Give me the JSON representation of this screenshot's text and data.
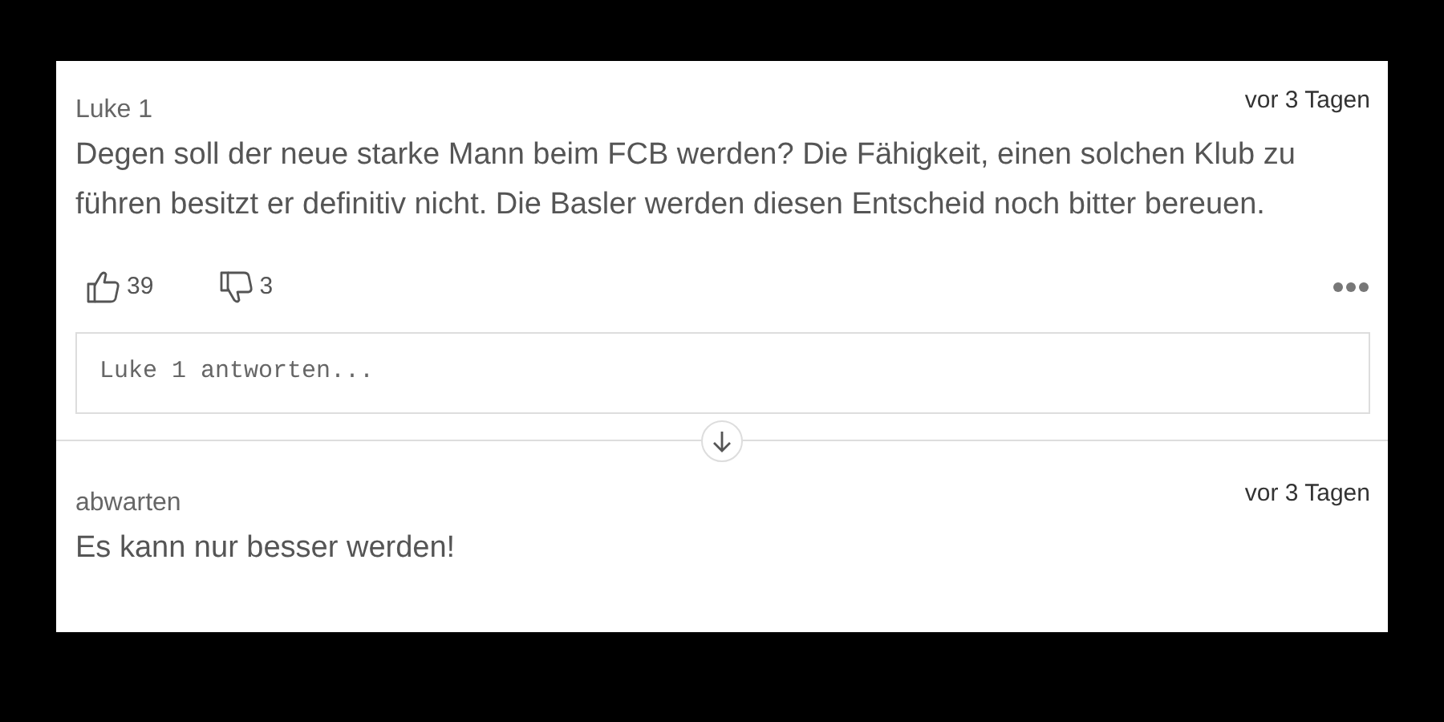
{
  "comments": [
    {
      "author": "Luke 1",
      "time": "vor 3 Tagen",
      "text": "Degen soll der neue starke Mann beim FCB werden? Die Fähigkeit, einen solchen Klub zu führen besitzt er definitiv nicht. Die Basler werden diesen Entscheid noch bitter bereuen.",
      "likes": "39",
      "dislikes": "3",
      "reply_placeholder": "Luke 1 antworten..."
    },
    {
      "author": "abwarten",
      "time": "vor 3 Tagen",
      "text": "Es kann nur besser werden!"
    }
  ]
}
